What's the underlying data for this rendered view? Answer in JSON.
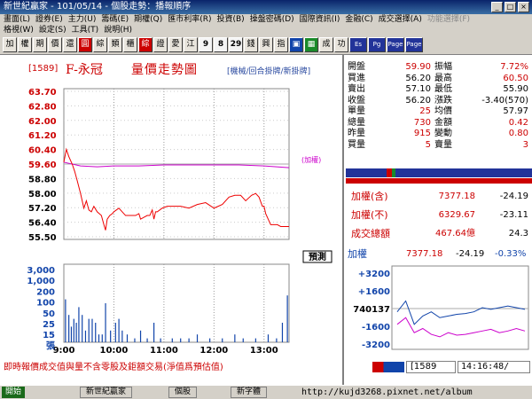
{
  "window": {
    "title": "新世紀贏家 - 101/05/14 - 個股走勢：播報順序"
  },
  "menu": {
    "row1": [
      "畫面(L)",
      "證券(E)",
      "主力(U)",
      "籌碼(E)",
      "期權(Q)",
      "匯市利率(R)",
      "投資(B)",
      "操盤密碼(D)",
      "國際資訊(I)",
      "金融(C)",
      "成交選擇(A)",
      "功能選擇(F)"
    ],
    "row1_disabled": [
      11
    ],
    "row2": [
      "格視(W)",
      "設定(S)",
      "工具(T)",
      "說明(H)"
    ]
  },
  "toolbar": {
    "buttons": [
      {
        "label": "加",
        "style": "plain"
      },
      {
        "label": "權",
        "style": "plain"
      },
      {
        "label": "期",
        "style": "plain"
      },
      {
        "label": "價",
        "style": "plain"
      },
      {
        "label": "還",
        "style": "plain"
      },
      {
        "label": "圓",
        "style": "red"
      },
      {
        "label": "綜",
        "style": "plain"
      },
      {
        "label": "類",
        "style": "plain"
      },
      {
        "label": "櫃",
        "style": "plain"
      },
      {
        "label": "綜",
        "style": "red"
      },
      {
        "label": "證",
        "style": "plain"
      },
      {
        "label": "愛",
        "style": "plain"
      },
      {
        "label": "江",
        "style": "plain"
      },
      {
        "label": "9",
        "style": "num"
      },
      {
        "label": "8",
        "style": "num"
      },
      {
        "label": "29",
        "style": "num"
      },
      {
        "label": "錢",
        "style": "plain"
      },
      {
        "label": "興",
        "style": "plain"
      },
      {
        "label": "指",
        "style": "plain"
      },
      {
        "label": "▣",
        "style": "blue"
      },
      {
        "label": "▦",
        "style": "green"
      },
      {
        "label": "成",
        "style": "plain"
      },
      {
        "label": "功",
        "style": "plain"
      },
      {
        "label": "Es",
        "style": "wide"
      },
      {
        "label": "Pg",
        "style": "wide"
      },
      {
        "label": "Page",
        "style": "wide"
      },
      {
        "label": "Page",
        "style": "wide"
      }
    ]
  },
  "stock": {
    "code": "[1589]",
    "name": "F-永冠",
    "chart_title": "量價走勢圖",
    "modes": "[機械/回合掛牌/新掛牌]"
  },
  "ref_label": "(加權)",
  "tag_label": "預測",
  "footer_note": "即時報價成交值與量不含零股及鉅額交易(淨值爲預估值)",
  "quote": {
    "rows": [
      {
        "l1": "開盤",
        "v1": "59.90",
        "c1": "#c00",
        "l2": "振幅",
        "v2": "7.72%",
        "c2": "#c00"
      },
      {
        "l1": "買進",
        "v1": "56.20",
        "c1": "#000",
        "l2": "最高",
        "v2": "60.50",
        "c2": "#c00"
      },
      {
        "l1": "賣出",
        "v1": "57.10",
        "c1": "#000",
        "l2": "最低",
        "v2": "55.90",
        "c2": "#000"
      },
      {
        "l1": "收盤",
        "v1": "56.20",
        "c1": "#000",
        "l2": "漲跌",
        "v2": "-3.40(570)",
        "c2": "#000"
      },
      {
        "l1": "單量",
        "v1": "25",
        "c1": "#c00",
        "l2": "均價",
        "v2": "57.97",
        "c2": "#000"
      },
      {
        "l1": "總量",
        "v1": "730",
        "c1": "#c00",
        "l2": "金額",
        "v2": "0.42",
        "c2": "#c00"
      },
      {
        "l1": "昨量",
        "v1": "915",
        "c1": "#c00",
        "l2": "變動",
        "v2": "0.80",
        "c2": "#c00"
      },
      {
        "l1": "買量",
        "v1": "5",
        "c1": "#c00",
        "l2": "賣量",
        "v2": "3",
        "c2": "#c00"
      }
    ],
    "index_rows": [
      {
        "label": "加權(含)",
        "value": "7377.18",
        "change": "-24.19"
      },
      {
        "label": "加權(不)",
        "value": "6329.67",
        "change": "-23.11"
      },
      {
        "label": "成交總額",
        "value": "467.64億",
        "change": "24.3"
      }
    ],
    "mini": {
      "label": "加權",
      "value": "7377.18",
      "change": "-24.19",
      "pct": "-0.33%"
    }
  },
  "status": {
    "code": "1589",
    "time": "14:16:48/"
  },
  "taskbar": {
    "url": "http://kujd3268.pixnet.net/album",
    "items": [
      "開始",
      "新世紀贏家",
      "個股",
      "新字體"
    ]
  },
  "chart_data": {
    "type": "line",
    "title": "量價走勢圖",
    "x_ticks": [
      "9:00",
      "10:00",
      "11:00",
      "12:00",
      "13:00"
    ],
    "x_range_minutes": [
      0,
      270
    ],
    "price": {
      "y_ticks": [
        "63.70",
        "62.80",
        "62.00",
        "61.20",
        "60.40",
        "59.60",
        "58.80",
        "58.00",
        "57.20",
        "56.40",
        "55.50"
      ],
      "ylim": [
        55.5,
        63.7
      ],
      "reference": 59.6,
      "times": [
        0,
        3,
        6,
        10,
        13,
        16,
        20,
        24,
        27,
        30,
        33,
        36,
        40,
        45,
        48,
        50,
        52,
        55,
        58,
        60,
        63,
        66,
        70,
        74,
        80,
        86,
        90,
        92,
        96,
        100,
        103,
        106,
        108,
        110,
        112,
        118,
        124,
        130,
        140,
        150,
        160,
        170,
        180,
        190,
        198,
        205,
        212,
        218,
        225,
        230,
        234,
        238,
        240,
        242,
        245,
        248,
        252,
        256,
        260,
        265,
        270
      ],
      "values": [
        59.7,
        60.4,
        60.0,
        59.6,
        59.2,
        58.7,
        58.0,
        57.2,
        57.6,
        57.1,
        57.0,
        57.3,
        57.0,
        56.8,
        56.3,
        56.0,
        56.6,
        56.8,
        56.9,
        57.0,
        57.1,
        57.2,
        57.0,
        56.8,
        56.8,
        56.8,
        56.9,
        56.6,
        56.7,
        56.8,
        56.8,
        57.1,
        56.6,
        57.0,
        57.0,
        57.2,
        57.3,
        57.3,
        57.3,
        57.2,
        57.4,
        57.5,
        57.2,
        57.4,
        57.8,
        57.9,
        57.9,
        57.6,
        57.9,
        58.0,
        57.8,
        57.3,
        57.3,
        56.9,
        56.6,
        56.3,
        56.3,
        56.3,
        56.2,
        56.2,
        56.2
      ]
    },
    "average": {
      "times": [
        0,
        20,
        40,
        60,
        90,
        120,
        150,
        180,
        210,
        240,
        270
      ],
      "values": [
        59.7,
        59.5,
        59.45,
        59.5,
        59.5,
        59.55,
        59.55,
        59.55,
        59.55,
        59.5,
        59.4
      ]
    },
    "volume": {
      "y_ticks": [
        "3,000",
        "1,000",
        "200",
        "100",
        "50",
        "25",
        "15",
        "張"
      ],
      "bars": [
        {
          "t": 2,
          "v": 0.55
        },
        {
          "t": 6,
          "v": 0.35
        },
        {
          "t": 9,
          "v": 0.2
        },
        {
          "t": 12,
          "v": 0.3
        },
        {
          "t": 15,
          "v": 0.25
        },
        {
          "t": 18,
          "v": 0.45
        },
        {
          "t": 22,
          "v": 0.35
        },
        {
          "t": 26,
          "v": 0.15
        },
        {
          "t": 30,
          "v": 0.3
        },
        {
          "t": 34,
          "v": 0.3
        },
        {
          "t": 38,
          "v": 0.25
        },
        {
          "t": 42,
          "v": 0.1
        },
        {
          "t": 46,
          "v": 0.1
        },
        {
          "t": 50,
          "v": 0.5
        },
        {
          "t": 56,
          "v": 0.15
        },
        {
          "t": 62,
          "v": 0.25
        },
        {
          "t": 66,
          "v": 0.3
        },
        {
          "t": 70,
          "v": 0.15
        },
        {
          "t": 76,
          "v": 0.1
        },
        {
          "t": 85,
          "v": 0.05
        },
        {
          "t": 92,
          "v": 0.15
        },
        {
          "t": 100,
          "v": 0.05
        },
        {
          "t": 108,
          "v": 0.25
        },
        {
          "t": 116,
          "v": 0.05
        },
        {
          "t": 130,
          "v": 0.05
        },
        {
          "t": 140,
          "v": 0.05
        },
        {
          "t": 150,
          "v": 0.05
        },
        {
          "t": 160,
          "v": 0.1
        },
        {
          "t": 175,
          "v": 0.05
        },
        {
          "t": 190,
          "v": 0.05
        },
        {
          "t": 205,
          "v": 0.1
        },
        {
          "t": 215,
          "v": 0.05
        },
        {
          "t": 230,
          "v": 0.05
        },
        {
          "t": 245,
          "v": 0.1
        },
        {
          "t": 255,
          "v": 0.05
        },
        {
          "t": 262,
          "v": 0.25
        },
        {
          "t": 268,
          "v": 0.6
        }
      ]
    },
    "mini_index": {
      "y_ticks": [
        "+3200",
        "+1600",
        "740137",
        "-1600",
        "-3200"
      ],
      "series": [
        {
          "color": "#14a",
          "values": [
            0.55,
            0.42,
            0.7,
            0.6,
            0.55,
            0.62,
            0.6,
            0.58,
            0.57,
            0.55,
            0.5,
            0.52,
            0.5,
            0.48,
            0.5,
            0.52
          ]
        },
        {
          "color": "#c0c",
          "values": [
            0.7,
            0.62,
            0.8,
            0.75,
            0.82,
            0.85,
            0.8,
            0.83,
            0.82,
            0.8,
            0.78,
            0.76,
            0.8,
            0.78,
            0.75,
            0.78
          ]
        }
      ]
    }
  }
}
